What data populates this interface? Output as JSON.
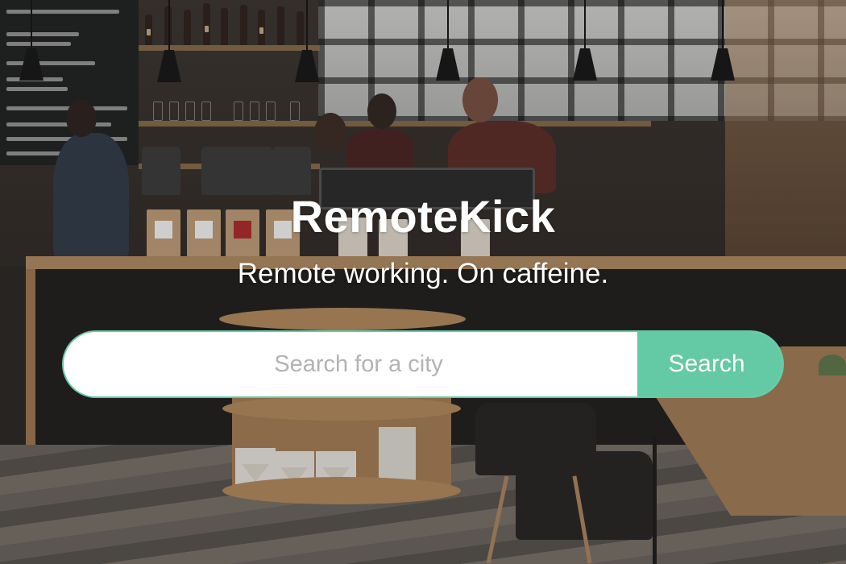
{
  "hero": {
    "title": "RemoteKick",
    "tagline": "Remote working. On caffeine."
  },
  "search": {
    "placeholder": "Search for a city",
    "value": "",
    "button_label": "Search"
  },
  "colors": {
    "accent": "#64c9a5",
    "text_on_image": "#ffffff",
    "placeholder": "#b3b3b3"
  },
  "background": {
    "scene": "cafe-interior-photo"
  }
}
